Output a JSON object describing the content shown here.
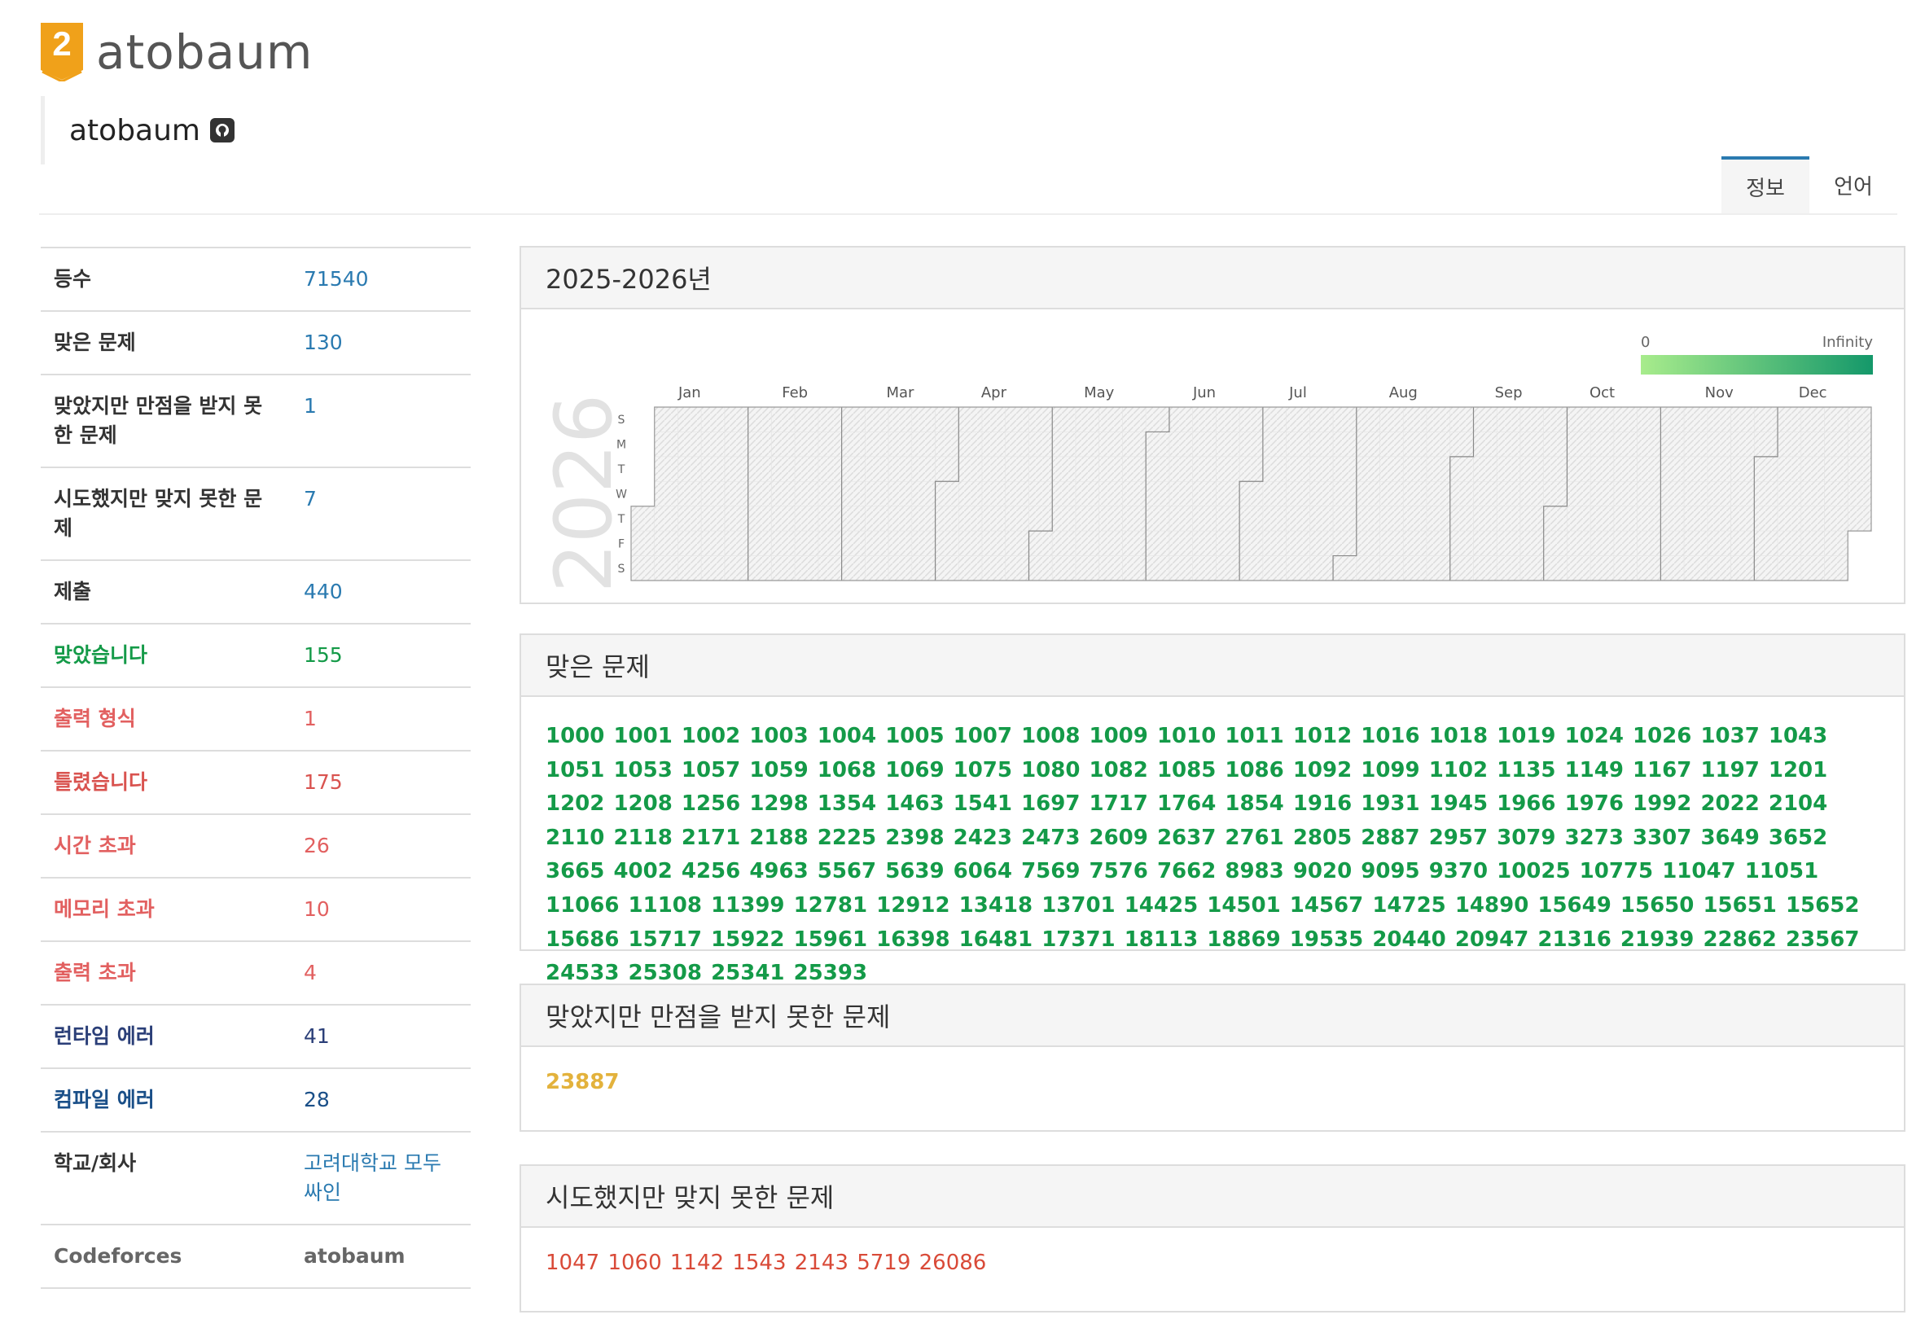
{
  "site": {
    "brand": "atobaum",
    "logo_number": "2"
  },
  "user": {
    "name": "atobaum",
    "github_icon": "github-icon"
  },
  "tabs": [
    "정보",
    "언어"
  ],
  "stats": [
    {
      "label": "등수",
      "value": "71540",
      "style": ""
    },
    {
      "label": "맞은 문제",
      "value": "130",
      "style": ""
    },
    {
      "label": "맞았지만 만점을 받지 못한 문제",
      "value": "1",
      "style": ""
    },
    {
      "label": "시도했지만 맞지 못한 문제",
      "value": "7",
      "style": ""
    },
    {
      "label": "제출",
      "value": "440",
      "style": ""
    },
    {
      "label": "맞았습니다",
      "value": "155",
      "style": "green"
    },
    {
      "label": "출력 형식",
      "value": "1",
      "style": "pink"
    },
    {
      "label": "틀렸습니다",
      "value": "175",
      "style": "red"
    },
    {
      "label": "시간 초과",
      "value": "26",
      "style": "pink"
    },
    {
      "label": "메모리 초과",
      "value": "10",
      "style": "pink"
    },
    {
      "label": "출력 초과",
      "value": "4",
      "style": "pink"
    },
    {
      "label": "런타임 에러",
      "value": "41",
      "style": "navy"
    },
    {
      "label": "컴파일 에러",
      "value": "28",
      "style": "blue"
    },
    {
      "label": "학교/회사",
      "value": "고려대학교 모두싸인",
      "style": ""
    },
    {
      "label": "Codeforces",
      "value": "atobaum",
      "style": "gray"
    }
  ],
  "heatmap": {
    "title": "2025-2026년",
    "year_label": "2026",
    "legend_min": "0",
    "legend_max": "Infinity",
    "months": [
      "Jan",
      "Feb",
      "Mar",
      "Apr",
      "May",
      "Jun",
      "Jul",
      "Aug",
      "Sep",
      "Oct",
      "Nov",
      "Dec"
    ],
    "days": [
      "S",
      "M",
      "T",
      "W",
      "T",
      "F",
      "S"
    ]
  },
  "solved": {
    "title": "맞은 문제",
    "problems": [
      "1000",
      "1001",
      "1002",
      "1003",
      "1004",
      "1005",
      "1007",
      "1008",
      "1009",
      "1010",
      "1011",
      "1012",
      "1016",
      "1018",
      "1019",
      "1024",
      "1026",
      "1037",
      "1043",
      "1051",
      "1053",
      "1057",
      "1059",
      "1068",
      "1069",
      "1075",
      "1080",
      "1082",
      "1085",
      "1086",
      "1092",
      "1099",
      "1102",
      "1135",
      "1149",
      "1167",
      "1197",
      "1201",
      "1202",
      "1208",
      "1256",
      "1298",
      "1354",
      "1463",
      "1541",
      "1697",
      "1717",
      "1764",
      "1854",
      "1916",
      "1931",
      "1945",
      "1966",
      "1976",
      "1992",
      "2022",
      "2104",
      "2110",
      "2118",
      "2171",
      "2188",
      "2225",
      "2398",
      "2423",
      "2473",
      "2609",
      "2637",
      "2761",
      "2805",
      "2887",
      "2957",
      "3079",
      "3273",
      "3307",
      "3649",
      "3652",
      "3665",
      "4002",
      "4256",
      "4963",
      "5567",
      "5639",
      "6064",
      "7569",
      "7576",
      "7662",
      "8983",
      "9020",
      "9095",
      "9370",
      "10025",
      "10775",
      "11047",
      "11051",
      "11066",
      "11108",
      "11399",
      "12781",
      "12912",
      "13418",
      "13701",
      "14425",
      "14501",
      "14567",
      "14725",
      "14890",
      "15649",
      "15650",
      "15651",
      "15652",
      "15686",
      "15717",
      "15922",
      "15961",
      "16398",
      "16481",
      "17371",
      "18113",
      "18869",
      "19535",
      "20440",
      "20947",
      "21316",
      "21939",
      "22862",
      "23567",
      "24533",
      "25308",
      "25341",
      "25393"
    ]
  },
  "partial": {
    "title": "맞았지만 만점을 받지 못한 문제",
    "problems": [
      "23887"
    ]
  },
  "failed": {
    "title": "시도했지만 맞지 못한 문제",
    "problems": [
      "1047",
      "1060",
      "1142",
      "1543",
      "2143",
      "5719",
      "26086"
    ]
  },
  "colors": {
    "accent": "#2a7ab0",
    "solved": "#149a48",
    "partial": "#e3b23c",
    "failed": "#d94a38",
    "legend_low": "#a8ec8c",
    "legend_high": "#14986a"
  }
}
